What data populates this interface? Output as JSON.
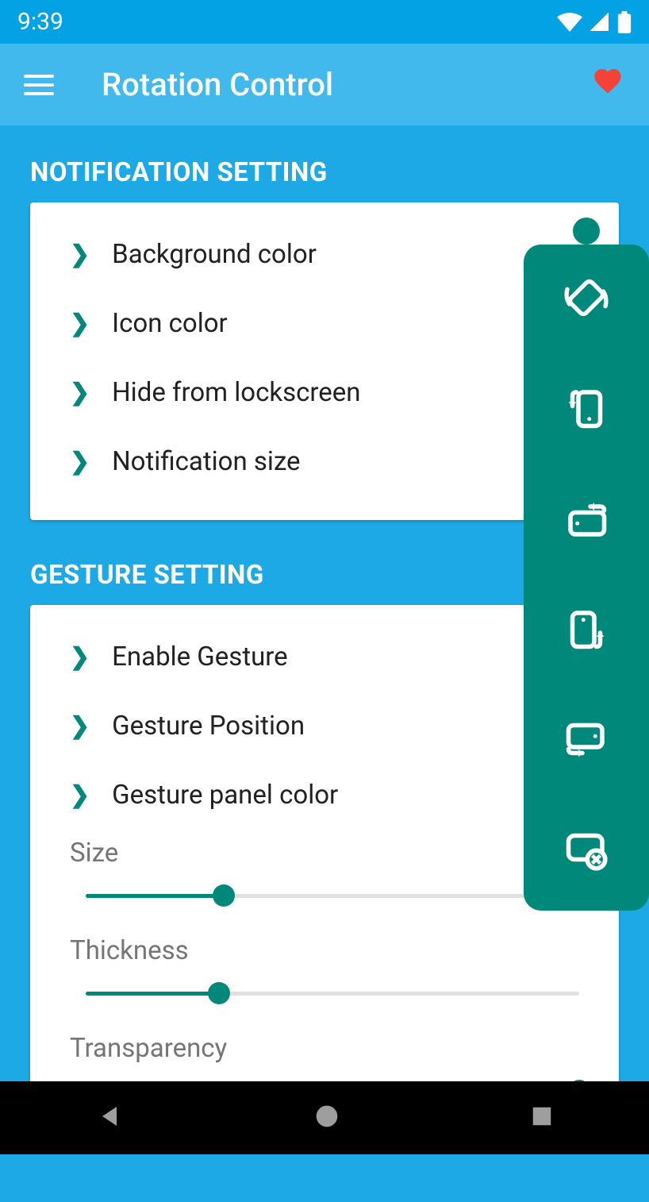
{
  "statusBar": {
    "time": "9:39"
  },
  "appBar": {
    "title": "Rotation Control"
  },
  "sections": {
    "notification": {
      "title": "NOTIFICATION SETTING",
      "items": {
        "backgroundColor": "Background color",
        "iconColor": "Icon color",
        "hideFromLockscreen": "Hide from lockscreen",
        "notificationSize": "Notification size"
      }
    },
    "gesture": {
      "title": "GESTURE SETTING",
      "items": {
        "enableGesture": "Enable Gesture",
        "gesturePosition": "Gesture Position",
        "gesturePanelColor": "Gesture panel color"
      },
      "sliders": {
        "size": {
          "label": "Size",
          "value": 28
        },
        "thickness": {
          "label": "Thickness",
          "value": 27
        },
        "transparency": {
          "label": "Transparency",
          "value": 100
        }
      }
    }
  },
  "floatingPanel": {
    "icons": [
      "auto-rotate",
      "rotate-portrait",
      "rotate-landscape-forward",
      "rotate-portrait-reverse",
      "rotate-landscape-down",
      "rotation-lock-off"
    ]
  }
}
